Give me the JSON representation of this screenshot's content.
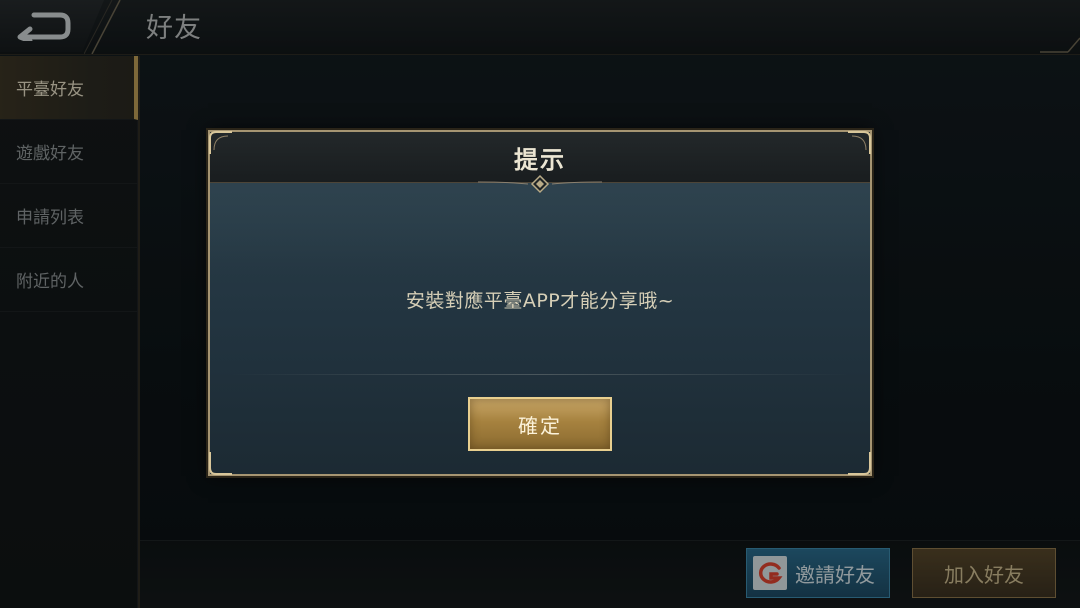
{
  "header": {
    "title": "好友"
  },
  "sidebar": {
    "items": [
      {
        "label": "平臺好友"
      },
      {
        "label": "遊戲好友"
      },
      {
        "label": "申請列表"
      },
      {
        "label": "附近的人"
      }
    ]
  },
  "bottom_bar": {
    "invite_label": "邀請好友",
    "add_label": "加入好友"
  },
  "dialog": {
    "title": "提示",
    "message": "安裝對應平臺APP才能分享哦~",
    "confirm_label": "確定"
  },
  "colors": {
    "accent_gold": "#c9a768",
    "active_tab_border": "#b89a55",
    "invite_blue": "#2a6a8a",
    "dialog_border": "#a69572"
  },
  "icons": {
    "back": "back-arrow-icon",
    "invite_logo": "platform-logo-icon"
  }
}
